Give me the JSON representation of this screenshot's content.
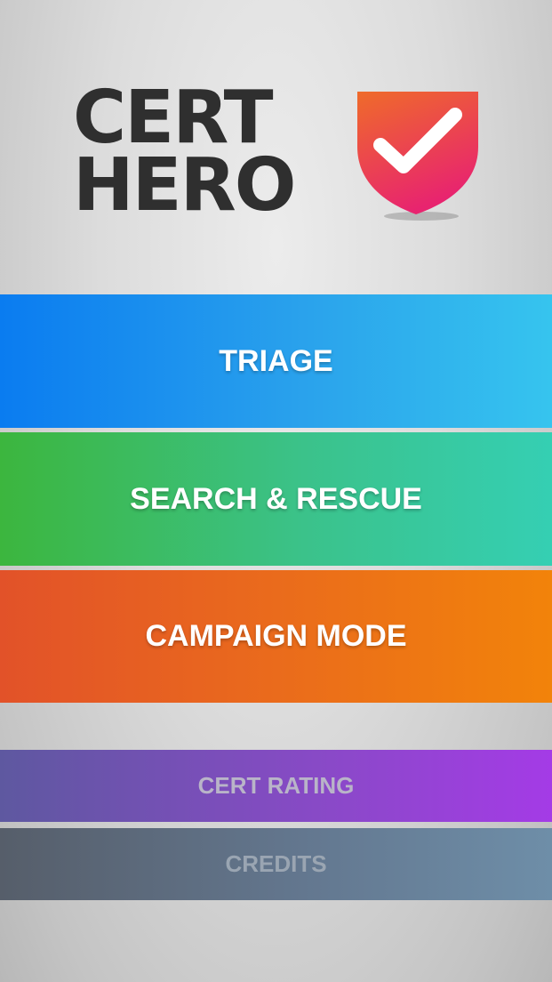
{
  "logo": {
    "line1": "CERT",
    "line2": "HERO",
    "shield_colors": {
      "top": "#ef6b2a",
      "bottom": "#e8246f",
      "check": "#ffffff"
    }
  },
  "menu": {
    "triage_label": "TRIAGE",
    "search_rescue_label": "SEARCH & RESCUE",
    "campaign_label": "CAMPAIGN MODE",
    "cert_rating_label": "CERT RATING",
    "credits_label": "CREDITS"
  },
  "colors": {
    "triage": "#1a8ff0",
    "search_rescue": "#3bc28a",
    "campaign": "#ea6b1c",
    "cert_rating": "#8a49c8",
    "credits": "#63778f",
    "logo_text": "#2f2f2f"
  }
}
